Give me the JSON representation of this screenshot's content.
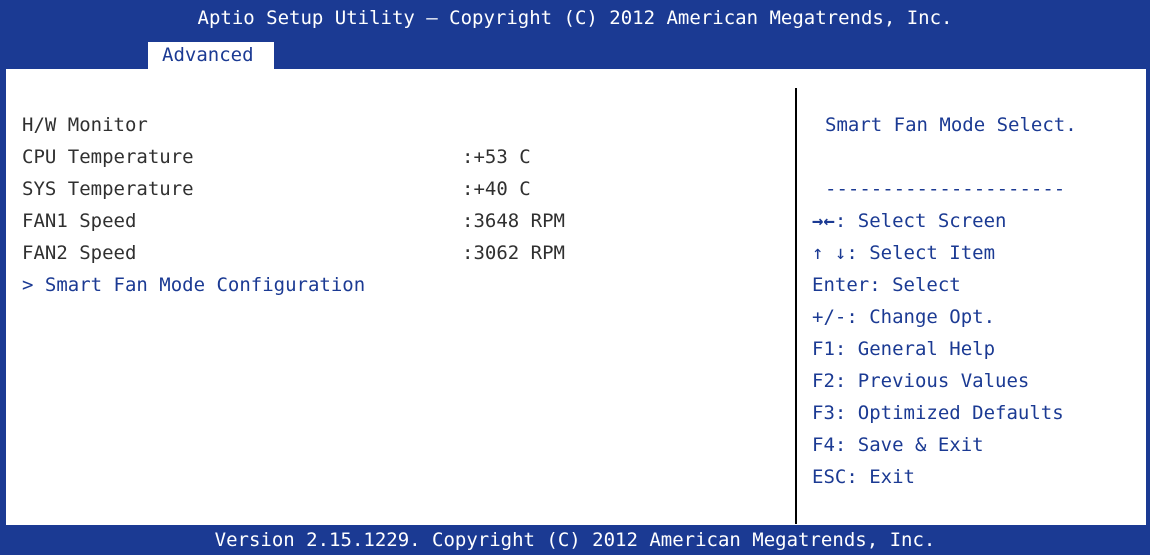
{
  "header": {
    "title": "Aptio Setup Utility – Copyright (C) 2012 American Megatrends, Inc."
  },
  "tabs": {
    "active": "Advanced"
  },
  "main": {
    "section_title": "H/W Monitor",
    "rows": [
      {
        "label": "CPU Temperature",
        "value": ":+53 C"
      },
      {
        "label": "SYS Temperature",
        "value": ":+40 C"
      },
      {
        "label": "FAN1 Speed",
        "value": ":3648 RPM"
      },
      {
        "label": "FAN2 Speed",
        "value": ":3062 RPM"
      }
    ],
    "submenu": "> Smart Fan Mode Configuration"
  },
  "help": {
    "description": "Smart Fan Mode Select.",
    "separator": "---------------------",
    "keys": [
      {
        "key": "→←",
        "text": ": Select Screen"
      },
      {
        "key": "↑ ↓",
        "text": ": Select Item"
      },
      {
        "key": "Enter",
        "text": ": Select"
      },
      {
        "key": "+/-",
        "text": ": Change Opt."
      },
      {
        "key": "F1",
        "text": ":  General Help"
      },
      {
        "key": "F2",
        "text": ":  Previous Values"
      },
      {
        "key": "F3",
        "text": ": Optimized Defaults"
      },
      {
        "key": "F4",
        "text": ": Save & Exit"
      },
      {
        "key": "ESC",
        "text": ": Exit"
      }
    ]
  },
  "footer": {
    "version": "Version 2.15.1229. Copyright (C) 2012 American Megatrends, Inc."
  },
  "colors": {
    "bar_blue": "#1b3a93",
    "text_gray": "#303030",
    "help_blue": "#1b3a93"
  }
}
